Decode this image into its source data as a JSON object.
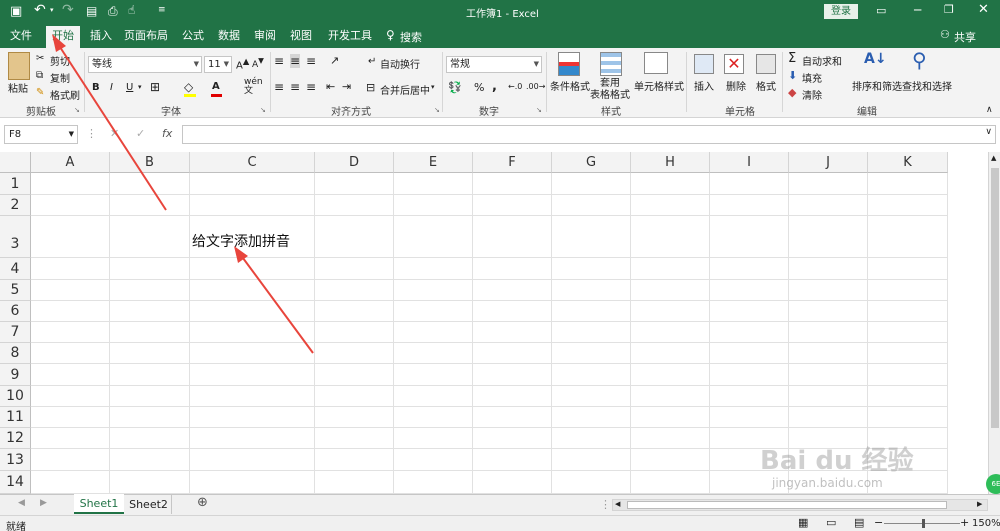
{
  "title_bar": {
    "title": "工作簿1  -  Excel",
    "login": "登录"
  },
  "tabs": [
    "文件",
    "开始",
    "插入",
    "页面布局",
    "公式",
    "数据",
    "审阅",
    "视图",
    "开发工具"
  ],
  "search": "搜索",
  "share": "共享",
  "ribbon": {
    "paste": "粘贴",
    "cut": "剪切",
    "copy": "复制",
    "format_painter": "格式刷",
    "clipboard": "剪贴板",
    "font_name": "等线",
    "font_size": "11",
    "font_group": "字体",
    "bold": "B",
    "italic": "I",
    "underline": "U",
    "font_color": "A",
    "wrap": "自动换行",
    "merge": "合并后居中",
    "align_group": "对齐方式",
    "num_format": "常规",
    "percent": "%",
    "comma": ",",
    "num_group": "数字",
    "cond_format": "条件格式",
    "table_format": "套用\n表格格式",
    "cell_style": "单元格样式",
    "style_group": "样式",
    "insert": "插入",
    "delete": "删除",
    "format": "格式",
    "cells_group": "单元格",
    "autosum": "自动求和",
    "fill": "填充",
    "clear": "清除",
    "sort": "排序和筛选",
    "find": "查找和选择",
    "edit_group": "编辑"
  },
  "formula_bar": {
    "namebox": "F8",
    "fx": "fx",
    "content": ""
  },
  "columns": [
    "A",
    "B",
    "C",
    "D",
    "E",
    "F",
    "G",
    "H",
    "I",
    "J",
    "K"
  ],
  "rows": [
    "1",
    "2",
    "3",
    "4",
    "5",
    "6",
    "7",
    "8",
    "9",
    "10",
    "11",
    "12",
    "13",
    "14"
  ],
  "cell_text": "给文字添加拼音",
  "sheets": [
    "Sheet1",
    "Sheet2"
  ],
  "status": {
    "ready": "就绪",
    "zoom": "150%"
  },
  "watermark": {
    "text": "Bai du 经验",
    "url": "jingyan.baidu.com"
  },
  "colors": {
    "excel_green": "#217346",
    "arrow_red": "#e8453c"
  }
}
